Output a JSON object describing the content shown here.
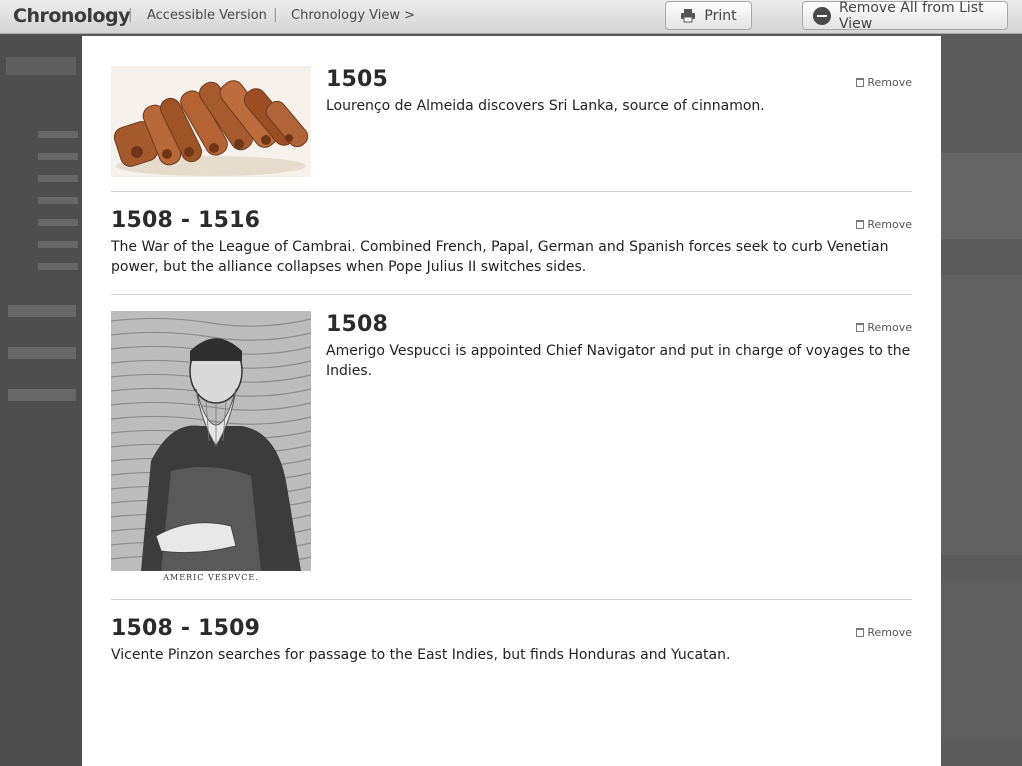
{
  "topbar": {
    "brand": "Chronology",
    "separator": "|",
    "accessible_link": "Accessible Version",
    "chronology_view_link": "Chronology View >",
    "print_label": "Print",
    "remove_all_label": "Remove All from List View"
  },
  "entries": [
    {
      "year": "1505",
      "description": "Lourenço de Almeida discovers Sri Lanka, source of cinnamon.",
      "remove_label": "Remove",
      "image": "cinnamon-sticks"
    },
    {
      "year": "1508 - 1516",
      "description": "The War of the League of Cambrai. Combined French, Papal, German and Spanish forces seek to curb Venetian power, but the alliance collapses when Pope Julius II switches sides.",
      "remove_label": "Remove"
    },
    {
      "year": "1508",
      "description": "Amerigo Vespucci is appointed Chief Navigator and put in charge of voyages to the Indies.",
      "remove_label": "Remove",
      "image": "engraved-portrait",
      "image_caption": "AMERIC VESPVCE."
    },
    {
      "year": "1508 - 1509",
      "description": "Vicente Pinzon searches for passage to the East Indies, but finds Honduras and Yucatan.",
      "remove_label": "Remove"
    }
  ]
}
